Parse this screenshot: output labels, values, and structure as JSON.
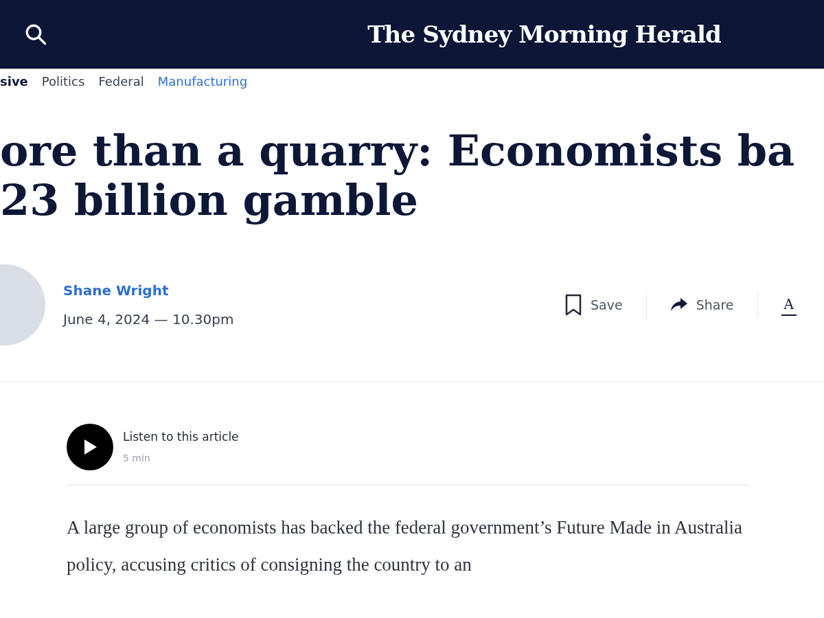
{
  "header": {
    "logo": "The Sydney Morning Herald"
  },
  "breadcrumbs": [
    {
      "label": "sive",
      "kind": "tag"
    },
    {
      "label": "Politics",
      "kind": "section"
    },
    {
      "label": "Federal",
      "kind": "section"
    },
    {
      "label": "Manufacturing",
      "kind": "topic"
    }
  ],
  "headline": [
    "ore than a quarry: Economists ba",
    "23 billion gamble"
  ],
  "byline": {
    "author": "Shane Wright",
    "date": "June 4, 2024 — 10.30pm"
  },
  "actions": [
    {
      "label": "Save",
      "kind": "save"
    },
    {
      "label": "Share",
      "kind": "share"
    },
    {
      "label": "A",
      "kind": "text-size"
    }
  ],
  "audio": {
    "label": "Listen to this article",
    "duration": "5 min"
  },
  "body": [
    "A large group of economists has backed the federal government’s Future Made in Australia policy, accusing critics of consigning the country to an"
  ]
}
